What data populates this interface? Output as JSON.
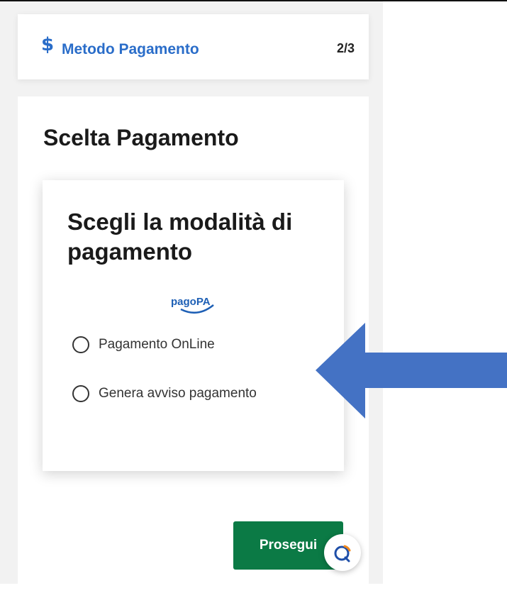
{
  "step_bar": {
    "icon": "dollar-icon",
    "icon_glyph": "$",
    "title": "Metodo Pagamento",
    "step": "2/3"
  },
  "section": {
    "title": "Scelta Pagamento"
  },
  "payment_card": {
    "title": "Scegli la modalità di pagamento",
    "logo_text": "pagoPA",
    "options": [
      {
        "label": "Pagamento OnLine",
        "selected": false
      },
      {
        "label": "Genera avviso pagamento",
        "selected": false
      }
    ]
  },
  "actions": {
    "next_label": "Prosegui"
  },
  "colors": {
    "accent_blue": "#2a6dc9",
    "button_green": "#0b7a45",
    "arrow_blue": "#4472c4"
  }
}
